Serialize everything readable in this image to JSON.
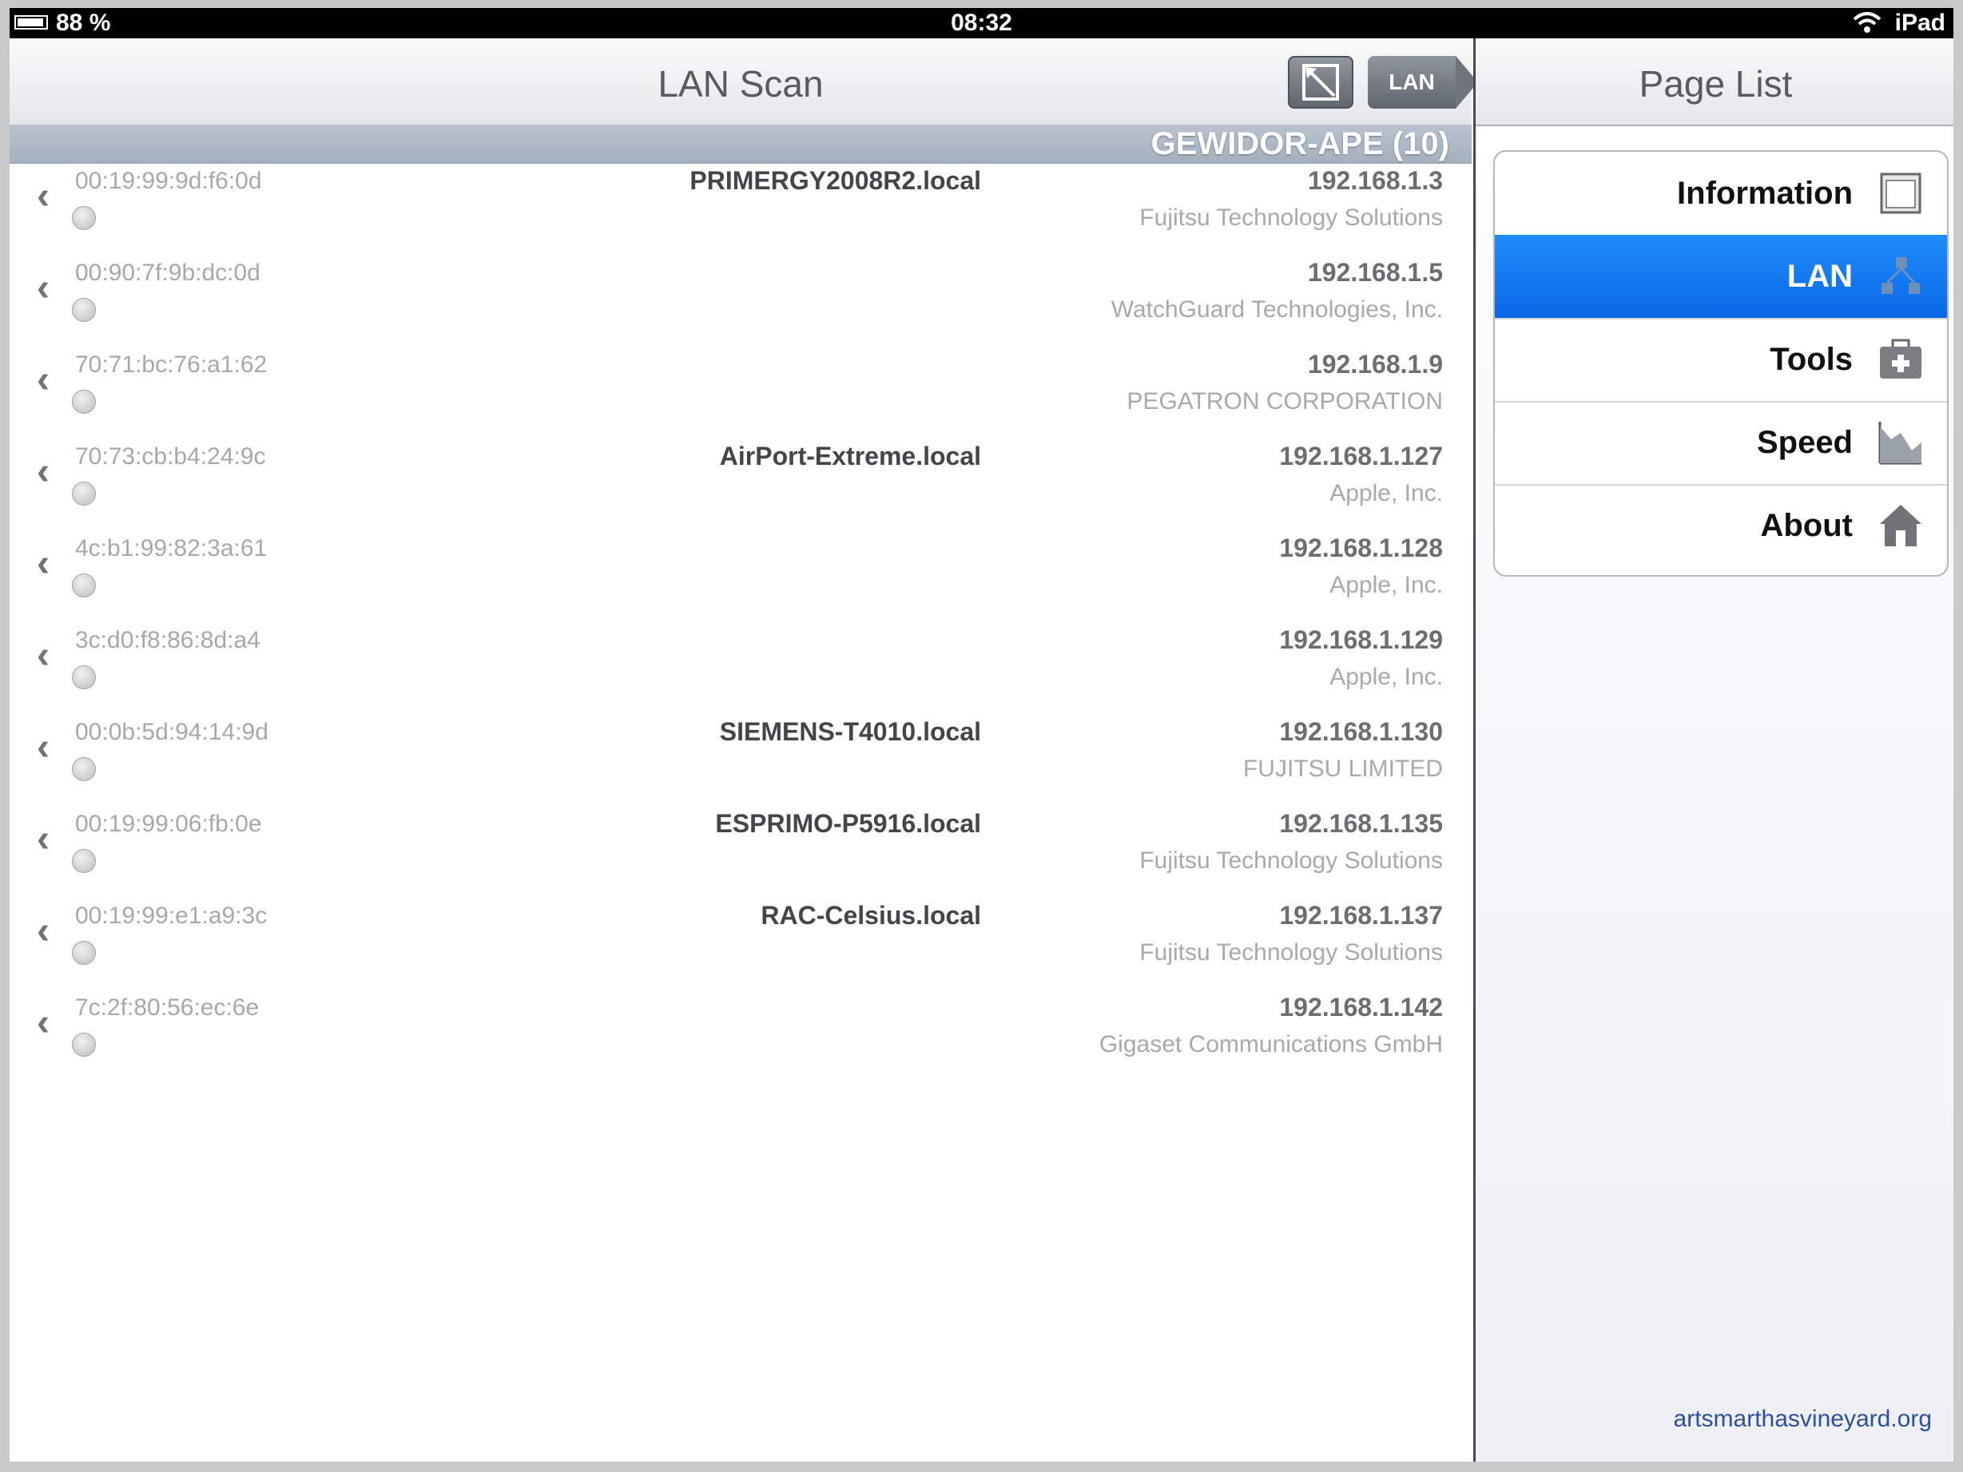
{
  "status_bar": {
    "battery": "88 %",
    "time": "08:32",
    "device": "iPad"
  },
  "content": {
    "title": "LAN Scan",
    "lan_button": "LAN",
    "section": "GEWIDOR-APE (10)",
    "devices": [
      {
        "mac": "00:19:99:9d:f6:0d",
        "host": "PRIMERGY2008R2.local",
        "ip": "192.168.1.3",
        "vendor": "Fujitsu Technology Solutions"
      },
      {
        "mac": "00:90:7f:9b:dc:0d",
        "host": "",
        "ip": "192.168.1.5",
        "vendor": "WatchGuard Technologies, Inc."
      },
      {
        "mac": "70:71:bc:76:a1:62",
        "host": "",
        "ip": "192.168.1.9",
        "vendor": "PEGATRON CORPORATION"
      },
      {
        "mac": "70:73:cb:b4:24:9c",
        "host": "AirPort-Extreme.local",
        "ip": "192.168.1.127",
        "vendor": "Apple, Inc."
      },
      {
        "mac": "4c:b1:99:82:3a:61",
        "host": "",
        "ip": "192.168.1.128",
        "vendor": "Apple, Inc."
      },
      {
        "mac": "3c:d0:f8:86:8d:a4",
        "host": "",
        "ip": "192.168.1.129",
        "vendor": "Apple, Inc."
      },
      {
        "mac": "00:0b:5d:94:14:9d",
        "host": "SIEMENS-T4010.local",
        "ip": "192.168.1.130",
        "vendor": "FUJITSU LIMITED"
      },
      {
        "mac": "00:19:99:06:fb:0e",
        "host": "ESPRIMO-P5916.local",
        "ip": "192.168.1.135",
        "vendor": "Fujitsu Technology Solutions"
      },
      {
        "mac": "00:19:99:e1:a9:3c",
        "host": "RAC-Celsius.local",
        "ip": "192.168.1.137",
        "vendor": "Fujitsu Technology Solutions"
      },
      {
        "mac": "7c:2f:80:56:ec:6e",
        "host": "",
        "ip": "192.168.1.142",
        "vendor": "Gigaset Communications GmbH"
      }
    ]
  },
  "page_list": {
    "title": "Page List",
    "items": [
      {
        "label": "Information",
        "icon": "window-icon",
        "selected": false
      },
      {
        "label": "LAN",
        "icon": "network-icon",
        "selected": true
      },
      {
        "label": "Tools",
        "icon": "toolbox-icon",
        "selected": false
      },
      {
        "label": "Speed",
        "icon": "chart-icon",
        "selected": false
      },
      {
        "label": "About",
        "icon": "house-icon",
        "selected": false
      }
    ],
    "footer": "artsmarthasvineyard.org"
  },
  "colors": {
    "selected": "#0b6ee8",
    "section": "#aab4c1"
  }
}
